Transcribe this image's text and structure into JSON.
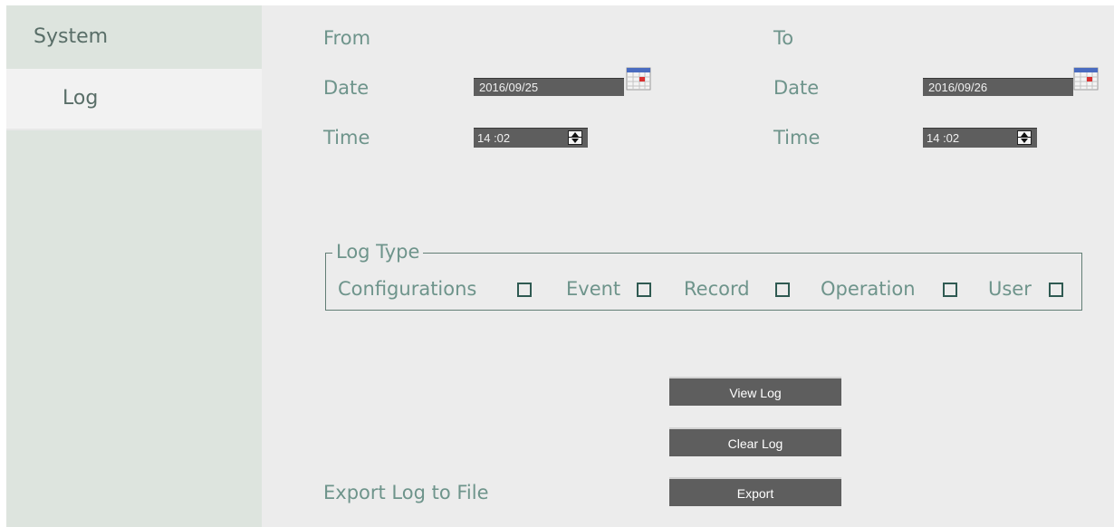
{
  "sidebar": {
    "header_label": "System",
    "items": [
      {
        "label": "Log",
        "selected": true
      }
    ]
  },
  "from": {
    "heading": "From",
    "date_label": "Date",
    "date_value": "2016/09/25",
    "time_label": "Time",
    "time_value": "14 :02"
  },
  "to": {
    "heading": "To",
    "date_label": "Date",
    "date_value": "2016/09/26",
    "time_label": "Time",
    "time_value": "14 :02"
  },
  "log_type": {
    "legend": "Log Type",
    "options": [
      {
        "label": "Configurations",
        "checked": false
      },
      {
        "label": "Event",
        "checked": false
      },
      {
        "label": "Record",
        "checked": false
      },
      {
        "label": "Operation",
        "checked": false
      },
      {
        "label": "User",
        "checked": false
      }
    ]
  },
  "buttons": {
    "view_log": "View Log",
    "clear_log": "Clear Log",
    "export": "Export"
  },
  "export_label": "Export Log to File",
  "icons": {
    "calendar": "calendar-icon",
    "spinner": "spinner-icon"
  },
  "colors": {
    "sidebar_bg": "#dde4de",
    "main_bg": "#ececec",
    "label_text": "#6e948b",
    "field_bg": "#5e5e5e"
  }
}
